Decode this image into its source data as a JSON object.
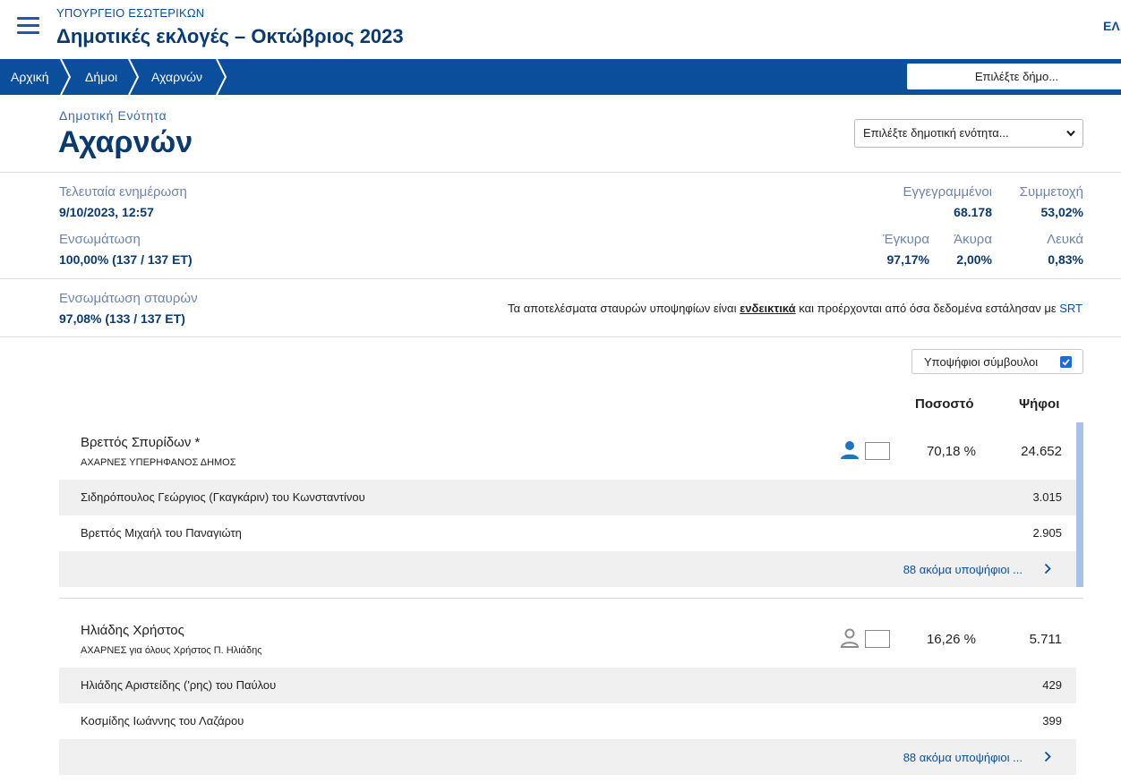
{
  "header": {
    "ministry": "ΥΠΟΥΡΓΕΙΟ ΕΣΩΤΕΡΙΚΩΝ",
    "title": "Δημοτικές εκλογές – Οκτώβριος 2023",
    "language": "ΕΛ"
  },
  "breadcrumb": {
    "items": [
      "Αρχική",
      "Δήμοι",
      "Αχαρνών"
    ],
    "municipality_select": "Επιλέξτε δήμο..."
  },
  "unit": {
    "kicker": "Δημοτική Ενότητα",
    "name": "Αχαρνών",
    "unit_select": "Επιλέξτε δημοτική ενότητα..."
  },
  "stats": {
    "last_update_label": "Τελευταία ενημέρωση",
    "last_update_value": "9/10/2023, 12:57",
    "integration_label": "Ενσωμάτωση",
    "integration_value": "100,00% (137 / 137 ΕΤ)",
    "registered_label": "Εγγεγραμμένοι",
    "registered_value": "68.178",
    "turnout_label": "Συμμετοχή",
    "turnout_value": "53,02%",
    "valid_label": "Έγκυρα",
    "valid_value": "97,17%",
    "invalid_label": "Άκυρα",
    "invalid_value": "2,00%",
    "blank_label": "Λευκά",
    "blank_value": "0,83%",
    "cross_label": "Ενσωμάτωση σταυρών",
    "cross_value": "97,08% (133 / 137 ΕΤ)"
  },
  "notice": {
    "before": "Τα αποτελέσματα σταυρών υποψηφίων είναι ",
    "emphasis": "ενδεικτικά",
    "middle": " και προέρχονται από όσα δεδομένα εστάλησαν με ",
    "link": "SRT"
  },
  "toggle": {
    "label": "Υποψήφιοι σύμβουλοι",
    "checked": true
  },
  "columns": {
    "percent": "Ποσοστό",
    "votes": "Ψήφοι"
  },
  "results": [
    {
      "candidate": "Βρεττός Σπυρίδων *",
      "party": "ΑΧΑΡΝΕΣ ΥΠΕΡΗΦΑΝΟΣ ΔΗΜΟΣ",
      "percent": "70,18 %",
      "votes": "24.652",
      "icon_color": "#1f72c4",
      "councillors": [
        {
          "name": "Σιδηρόπουλος Γεώργιος (Γκαγκάριν) του Κωνσταντίνου",
          "votes": "3.015"
        },
        {
          "name": "Βρεττός Μιχαήλ του Παναγιώτη",
          "votes": "2.905"
        }
      ],
      "more": "88 ακόμα υποψήφιοι ..."
    },
    {
      "candidate": "Ηλιάδης Χρήστος",
      "party": "ΑΧΑΡΝΕΣ για όλους Χρήστος Π. Ηλιάδης",
      "percent": "16,26 %",
      "votes": "5.711",
      "icon_color": "#8c8c8c",
      "councillors": [
        {
          "name": "Ηλιάδης Αριστείδης ('ρης) του Παύλου",
          "votes": "429"
        },
        {
          "name": "Κοσμίδης Ιωάννης του Λαζάρου",
          "votes": "399"
        }
      ],
      "more": "88 ακόμα υποψήφιοι ..."
    }
  ]
}
